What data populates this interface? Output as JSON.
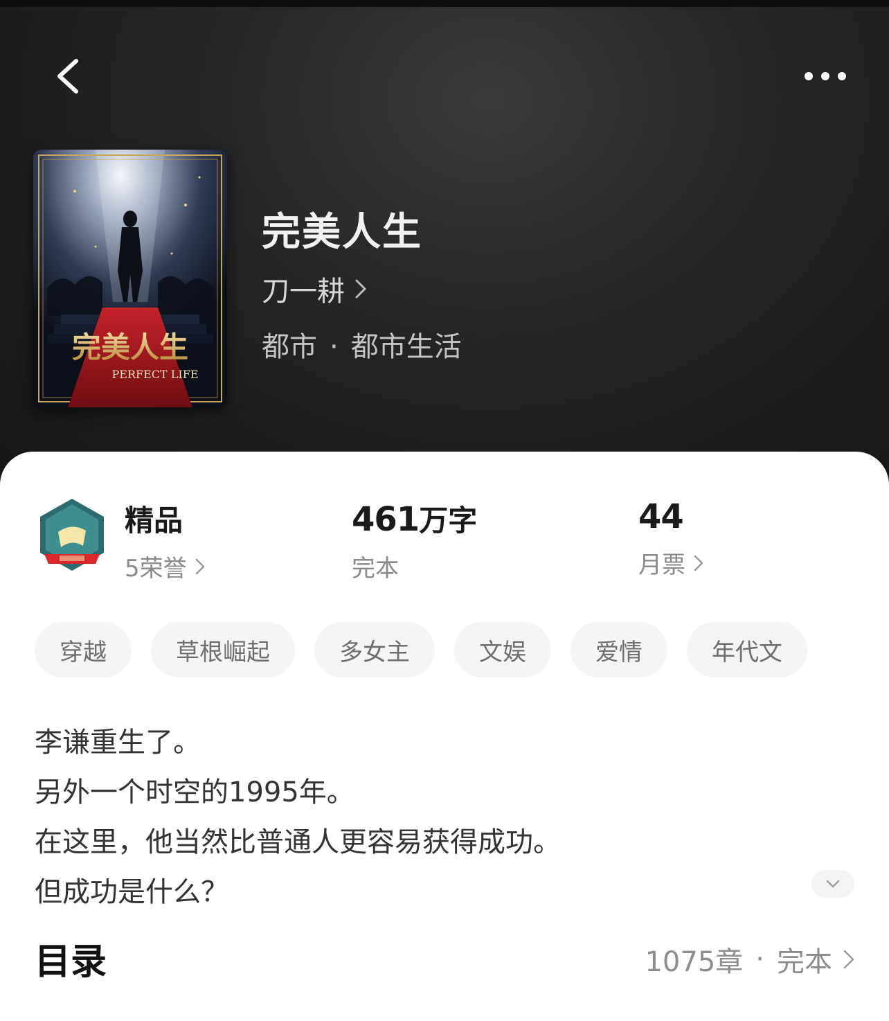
{
  "nav": {
    "back_icon": "chevron-left-icon",
    "more_icon": "more-horizontal-icon"
  },
  "book": {
    "cover_title": "完美人生",
    "cover_subtitle": "PERFECT LIFE",
    "title": "完美人生",
    "author": "刀一耕",
    "category": "都市",
    "separator": "·",
    "subcategory": "都市生活"
  },
  "stats": {
    "quality_label": "精品",
    "honors": "5荣誉",
    "word_count_number": "461",
    "word_count_unit": "万字",
    "status": "完本",
    "monthly_votes": "44",
    "monthly_votes_label": "月票"
  },
  "tags": [
    "穿越",
    "草根崛起",
    "多女主",
    "文娱",
    "爱情",
    "年代文"
  ],
  "intro": [
    "李谦重生了。",
    "另外一个时空的1995年。",
    "在这里，他当然比普通人更容易获得成功。",
    "但成功是什么？"
  ],
  "toc": {
    "label": "目录",
    "chapters": "1075章",
    "separator": "·",
    "status": "完本"
  },
  "colors": {
    "hero_bg": "#1b1b1b",
    "card_bg": "#ffffff",
    "tag_bg": "#f5f5f5",
    "muted_text": "#8a8a8a"
  }
}
